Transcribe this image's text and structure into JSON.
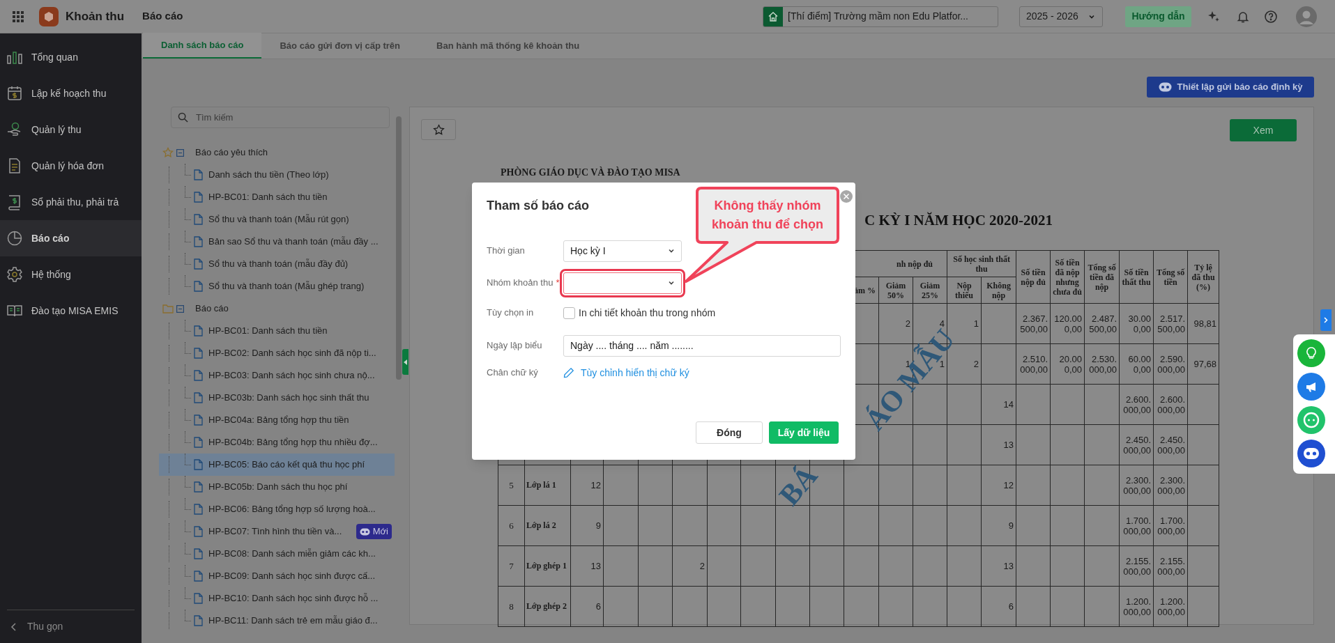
{
  "app_bar": {
    "app_name": "Khoản thu",
    "page_title": "Báo cáo",
    "school": "[Thí điểm] Trường mầm non Edu Platfor...",
    "school_year": "2025 - 2026",
    "guide_button": "Hướng dẫn"
  },
  "sidebar": {
    "items": [
      {
        "label": "Tổng quan",
        "selected": false
      },
      {
        "label": "Lập kế hoạch thu",
        "selected": false
      },
      {
        "label": "Quản lý thu",
        "selected": false
      },
      {
        "label": "Quản lý hóa đơn",
        "selected": false
      },
      {
        "label": "Sổ phải thu, phải trả",
        "selected": false
      },
      {
        "label": "Báo cáo",
        "selected": true
      },
      {
        "label": "Hệ thống",
        "selected": false
      },
      {
        "label": "Đào tạo MISA EMIS",
        "selected": false
      }
    ],
    "collapse_label": "Thu gọn"
  },
  "tabs": [
    {
      "label": "Danh sách báo cáo",
      "selected": true
    },
    {
      "label": "Báo cáo gửi đơn vị cấp trên",
      "selected": false
    },
    {
      "label": "Ban hành mã thống kê khoản thu",
      "selected": false
    }
  ],
  "schedule_button": "Thiết lập gửi báo cáo định kỳ",
  "report_tree": {
    "search": {
      "placeholder": "Tìm kiếm"
    },
    "groups": [
      {
        "label": "Báo cáo yêu thích",
        "kind": "favorites",
        "expanded": true,
        "children": [
          {
            "label": "Danh sách thu tiền (Theo lớp)",
            "selected": false
          },
          {
            "label": "HP-BC01: Danh sách thu tiền",
            "selected": false
          },
          {
            "label": "Sổ thu và thanh toán (Mẫu rút gọn)",
            "selected": false
          },
          {
            "label": "Bản sao Sổ thu và thanh toán (mẫu đầy ...",
            "selected": false
          },
          {
            "label": "Sổ thu và thanh toán (mẫu đầy đủ)",
            "selected": false
          },
          {
            "label": "Sổ thu và thanh toán (Mẫu ghép trang)",
            "selected": false
          }
        ]
      },
      {
        "label": "Báo cáo",
        "kind": "folder",
        "expanded": true,
        "children": [
          {
            "label": "HP-BC01: Danh sách thu tiền",
            "selected": false
          },
          {
            "label": "HP-BC02: Danh sách học sinh đã nộp ti...",
            "selected": false
          },
          {
            "label": "HP-BC03: Danh sách học sinh chưa nộ...",
            "selected": false
          },
          {
            "label": "HP-BC03b: Danh sách học sinh thất thu",
            "selected": false
          },
          {
            "label": "HP-BC04a: Bảng tổng hợp thu tiền",
            "selected": false
          },
          {
            "label": "HP-BC04b: Bảng tổng hợp thu nhiều đợ...",
            "selected": false
          },
          {
            "label": "HP-BC05: Báo cáo kết quả thu học phí",
            "selected": true
          },
          {
            "label": "HP-BC05b: Danh sách thu học phí",
            "selected": false
          },
          {
            "label": "HP-BC06: Bảng tổng hợp số lượng hoà...",
            "selected": false
          },
          {
            "label": "HP-BC07: Tình hình thu tiền và...",
            "selected": false,
            "badge": "Mới"
          },
          {
            "label": "HP-BC08: Danh sách miễn giảm các kh...",
            "selected": false
          },
          {
            "label": "HP-BC09: Danh sách học sinh được cấ...",
            "selected": false
          },
          {
            "label": "HP-BC10: Danh sách học sinh được hỗ ...",
            "selected": false
          },
          {
            "label": "HP-BC11: Danh sách trẻ em mẫu giáo đ...",
            "selected": false
          }
        ]
      }
    ]
  },
  "preview": {
    "view_button": "Xem",
    "org_line": "PHÒNG GIÁO DỤC VÀ ĐÀO TẠO MISA",
    "title_fragment": "C KỲ I NĂM HỌC 2020-2021",
    "stamp_fragments": [
      "BÁ",
      "ÁO MẪU"
    ],
    "header": {
      "paid_full_group": "nh nộp đủ",
      "reduced_partial": "ảm %",
      "reduced_50": "Giảm 50%",
      "reduced_25": "Giảm 25%",
      "lost_group": "Số học sinh thất thu",
      "paid_partial": "Nộp thiếu",
      "unpaid": "Không nộp",
      "amount_full": "Số tiền nộp đủ",
      "amount_partial": "Số tiền đã nộp nhưng chưa đủ",
      "amount_paid_total": "Tổng số tiền đã nộp",
      "amount_lost": "Số tiền thất thu",
      "amount_total": "Tổng số tiền",
      "collected_rate": "Tỷ lệ đã thu (%)"
    },
    "rows": [
      {
        "reduced_50": "2",
        "reduced_25": "4",
        "paid_partial": "1",
        "amount_full": "2.367.500,00",
        "amount_partial": "120.000,00",
        "amount_paid_total": "2.487.500,00",
        "amount_lost": "30.000,00",
        "amount_total": "2.517.500,00",
        "collected_rate": "98,81"
      },
      {
        "reduced_50": "1",
        "reduced_25": "1",
        "paid_partial": "2",
        "amount_full": "2.510.000,00",
        "amount_partial": "20.000,00",
        "amount_paid_total": "2.530.000,00",
        "amount_lost": "60.000,00",
        "amount_total": "2.590.000,00",
        "collected_rate": "97,68"
      },
      {
        "unpaid": "14",
        "amount_lost": "2.600.000,00",
        "amount_total": "2.600.000,00"
      },
      {
        "unpaid": "13",
        "amount_lost": "2.450.000,00",
        "amount_total": "2.450.000,00"
      },
      {
        "no": "5",
        "class_name": "Lớp lá 1",
        "students": "12",
        "unpaid": "12",
        "amount_lost": "2.300.000,00",
        "amount_total": "2.300.000,00"
      },
      {
        "no": "6",
        "class_name": "Lớp lá 2",
        "students": "9",
        "unpaid": "9",
        "amount_lost": "1.700.000,00",
        "amount_total": "1.700.000,00"
      },
      {
        "no": "7",
        "class_name": "Lớp ghép 1",
        "students": "13",
        "column_6": "2",
        "unpaid": "13",
        "amount_lost": "2.155.000,00",
        "amount_total": "2.155.000,00"
      },
      {
        "no": "8",
        "class_name": "Lớp ghép 2",
        "students": "6",
        "unpaid": "6",
        "amount_lost": "1.200.000,00",
        "amount_total": "1.200.000,00"
      }
    ]
  },
  "dialog": {
    "title": "Tham số báo cáo",
    "fields": [
      {
        "kind": "select",
        "label": "Thời gian",
        "value": "Học kỳ I"
      },
      {
        "kind": "select",
        "label": "Nhóm khoản thu",
        "required_mark": "*",
        "highlighted": true
      },
      {
        "kind": "checkbox",
        "label": "Tùy chọn in",
        "option": "In chi tiết khoản thu trong nhóm",
        "checked": false
      },
      {
        "kind": "text",
        "label": "Ngày lập biểu",
        "value": "Ngày .... tháng .... năm ........"
      },
      {
        "kind": "link",
        "label": "Chân chữ ký",
        "link": "Tùy chỉnh hiển thị chữ ký"
      }
    ],
    "buttons": [
      {
        "label": "Đóng",
        "kind": "secondary"
      },
      {
        "label": "Lấy dữ liệu",
        "kind": "primary"
      }
    ]
  },
  "callout": {
    "text": "Không thấy nhóm khoản thu để chọn"
  }
}
